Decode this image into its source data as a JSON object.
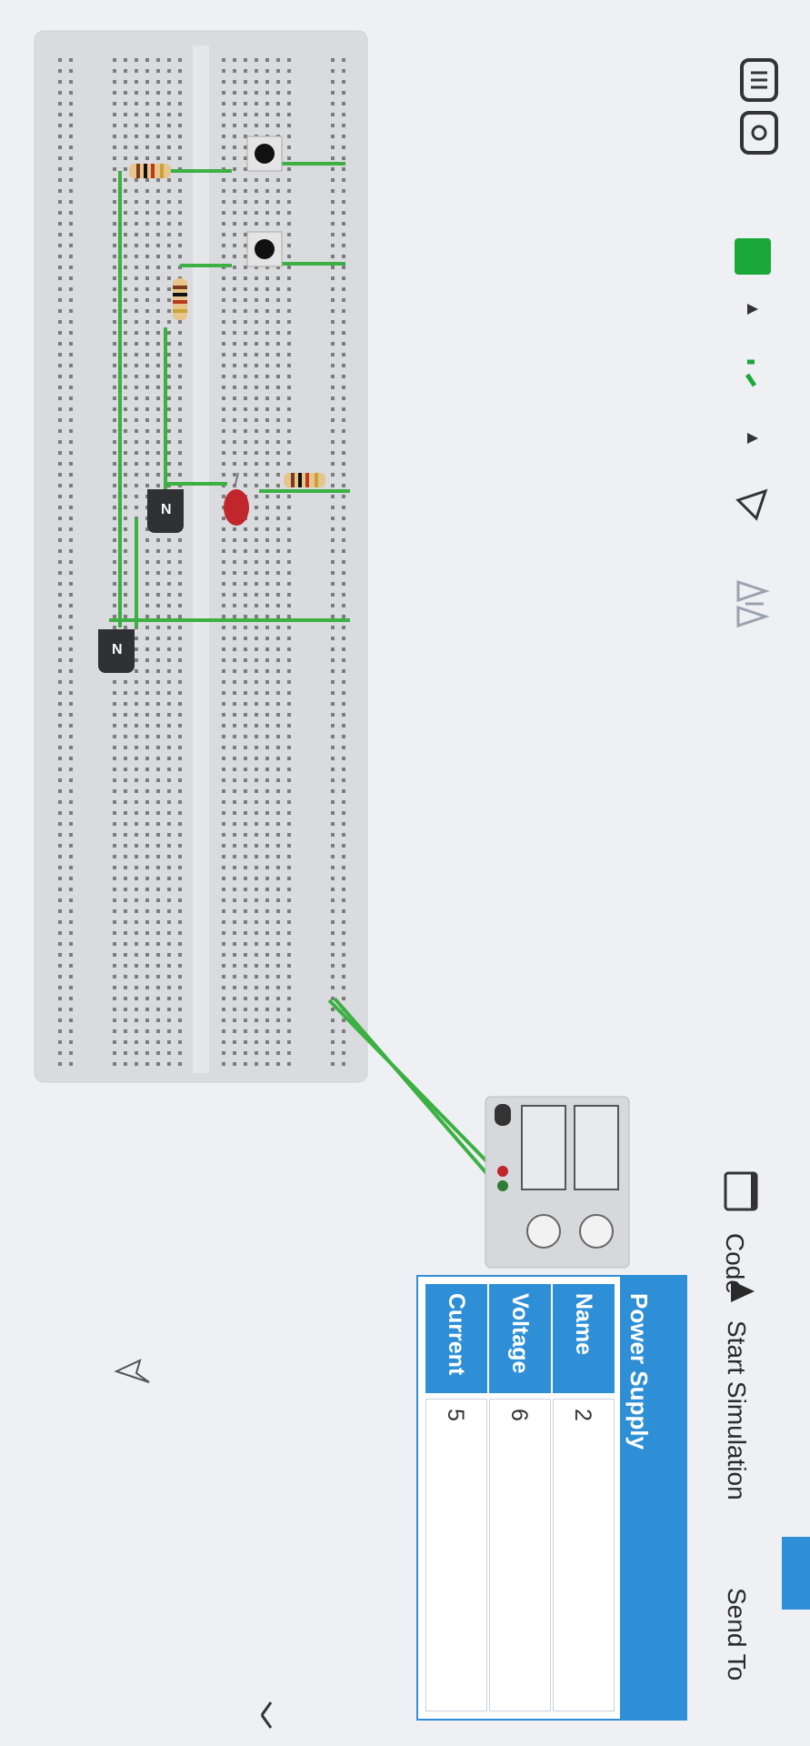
{
  "toolbar": {
    "code_label": "Code",
    "start_simulation_label": "Start Simulation",
    "send_to_label": "Send To"
  },
  "component_badges": {
    "transistor_label": "N"
  },
  "properties": {
    "title": "Power Supply",
    "rows": [
      {
        "label": "Name",
        "value": "2"
      },
      {
        "label": "Voltage",
        "value": "6"
      },
      {
        "label": "Current",
        "value": "5"
      }
    ]
  },
  "colors": {
    "accent": "#2f8fd6",
    "wire": "#3cb043",
    "led": "#c0262b",
    "shape_fill": "#1aa83a"
  },
  "icons": [
    "notes-icon",
    "comment-icon",
    "color-swatch-icon",
    "line-style-icon",
    "rotate-icon",
    "mirror-icon",
    "code-icon",
    "play-icon",
    "collapse-icon",
    "cursor-icon"
  ]
}
